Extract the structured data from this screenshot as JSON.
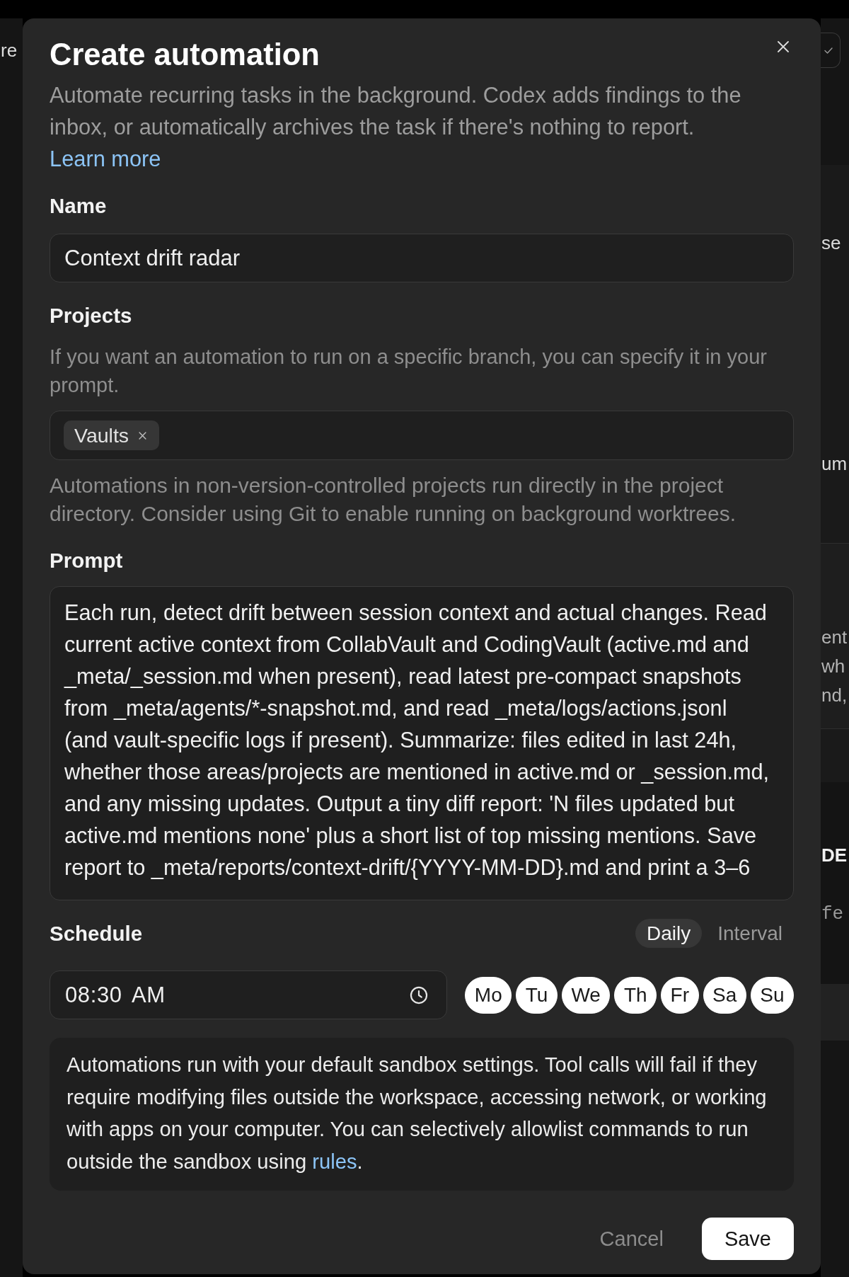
{
  "background_app": {
    "left_text": "re",
    "right_sections": [
      {
        "kind": "toolbar"
      },
      {
        "kind": "panel",
        "texts": [
          "se",
          "um"
        ]
      },
      {
        "kind": "panel",
        "texts": [
          "ent",
          "wh",
          "nd,"
        ]
      },
      {
        "kind": "panel"
      },
      {
        "kind": "code",
        "heading": "DE",
        "texts": [
          "fe"
        ]
      },
      {
        "kind": "panel"
      },
      {
        "kind": "panel"
      }
    ]
  },
  "dialog": {
    "title": "Create automation",
    "description": "Automate recurring tasks in the background. Codex adds findings to the inbox, or automatically archives the task if there's nothing to report.",
    "description_link": "Learn more"
  },
  "name": {
    "label": "Name",
    "value": "Context drift radar"
  },
  "projects": {
    "label": "Projects",
    "hint": "If you want an automation to run on a specific branch, you can specify it in your prompt.",
    "chips": [
      {
        "label": "Vaults"
      }
    ],
    "note": "Automations in non-version-controlled projects run directly in the project directory. Consider using Git to enable running on background worktrees."
  },
  "prompt": {
    "label": "Prompt",
    "value": "Each run, detect drift between session context and actual changes. Read current active context from CollabVault and CodingVault (active.md and _meta/_session.md when present), read latest pre-compact snapshots from _meta/agents/*-snapshot.md, and read _meta/logs/actions.jsonl (and vault-specific logs if present). Summarize: files edited in last 24h, whether those areas/projects are mentioned in active.md or _session.md, and any missing updates. Output a tiny diff report: 'N files updated but active.md mentions none' plus a short list of top missing mentions. Save report to _meta/reports/context-drift/{YYYY-MM-DD}.md and print a 3–6"
  },
  "schedule": {
    "label": "Schedule",
    "modes": [
      {
        "label": "Daily",
        "selected": true
      },
      {
        "label": "Interval",
        "selected": false
      }
    ],
    "time": "08:30 AM",
    "days": [
      {
        "label": "Mo",
        "selected": true
      },
      {
        "label": "Tu",
        "selected": true
      },
      {
        "label": "We",
        "selected": true
      },
      {
        "label": "Th",
        "selected": true
      },
      {
        "label": "Fr",
        "selected": true
      },
      {
        "label": "Sa",
        "selected": true
      },
      {
        "label": "Su",
        "selected": true
      }
    ]
  },
  "notice": {
    "text": "Automations run with your default sandbox settings. Tool calls will fail if they require modifying files outside the workspace, accessing network, or working with apps on your computer. You can selectively allowlist commands to run outside the sandbox using",
    "link": "rules",
    "after": "."
  },
  "buttons": [
    {
      "label": "Cancel",
      "kind": "secondary"
    },
    {
      "label": "Save",
      "kind": "primary"
    }
  ]
}
